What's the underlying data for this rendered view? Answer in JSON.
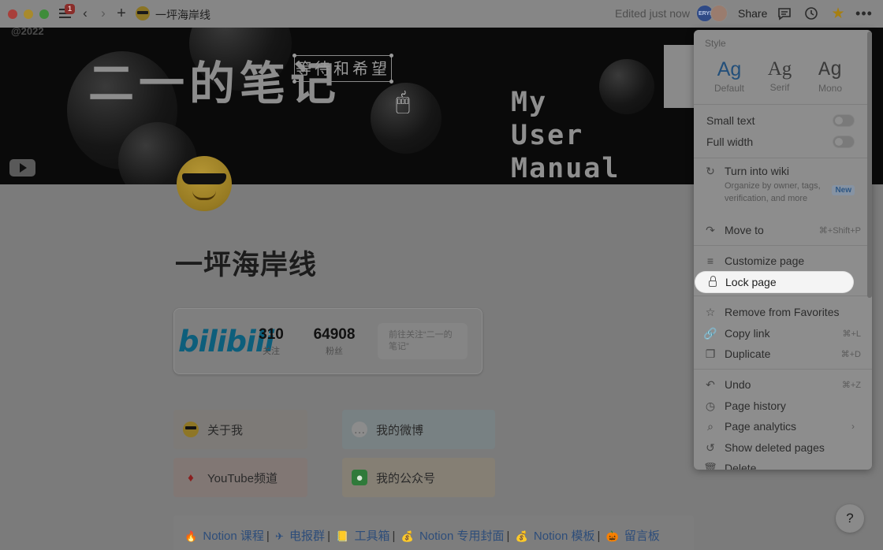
{
  "titlebar": {
    "notification_count": "1",
    "breadcrumb": "一坪海岸线",
    "edited_status": "Edited just now",
    "avatar_initials": "ERYI",
    "share_label": "Share"
  },
  "cover": {
    "year": "@2022",
    "title": "二一的笔记",
    "subtitle": "等待和希望",
    "manual_lines": [
      "My",
      "User",
      "Manual"
    ]
  },
  "page": {
    "title": "一坪海岸线",
    "bilibili": {
      "logo": "bilibili",
      "following_count": "310",
      "following_label": "关注",
      "fans_count": "64908",
      "fans_label": "粉丝",
      "follow_button": "前往关注“二一的笔记”"
    },
    "tiles": {
      "about": "关于我",
      "weibo": "我的微博",
      "youtube": "YouTube频道",
      "wechat": "我的公众号"
    },
    "links": [
      {
        "icon": "🔥",
        "label": "Notion 课程"
      },
      {
        "icon": "✈",
        "label": "电报群"
      },
      {
        "icon": "📒",
        "label": "工具箱"
      },
      {
        "icon": "💰",
        "label": "Notion 专用封面"
      },
      {
        "icon": "💰",
        "label": "Notion 模板"
      },
      {
        "icon": "🎃",
        "label": "留言板"
      }
    ],
    "help_label": "?"
  },
  "menu": {
    "style_label": "Style",
    "fonts": [
      {
        "sample": "Ag",
        "name": "Default"
      },
      {
        "sample": "Ag",
        "name": "Serif"
      },
      {
        "sample": "Ag",
        "name": "Mono"
      }
    ],
    "small_text": "Small text",
    "full_width": "Full width",
    "turn_into_wiki": "Turn into wiki",
    "wiki_description": "Organize by owner, tags, verification, and more",
    "new_badge": "New",
    "move_to": "Move to",
    "move_to_shortcut": "⌘+Shift+P",
    "customize_page": "Customize page",
    "lock_page": "Lock page",
    "remove_favorites": "Remove from Favorites",
    "copy_link": "Copy link",
    "copy_link_shortcut": "⌘+L",
    "duplicate": "Duplicate",
    "duplicate_shortcut": "⌘+D",
    "undo": "Undo",
    "undo_shortcut": "⌘+Z",
    "page_history": "Page history",
    "page_analytics": "Page analytics",
    "show_deleted": "Show deleted pages",
    "delete": "Delete"
  }
}
